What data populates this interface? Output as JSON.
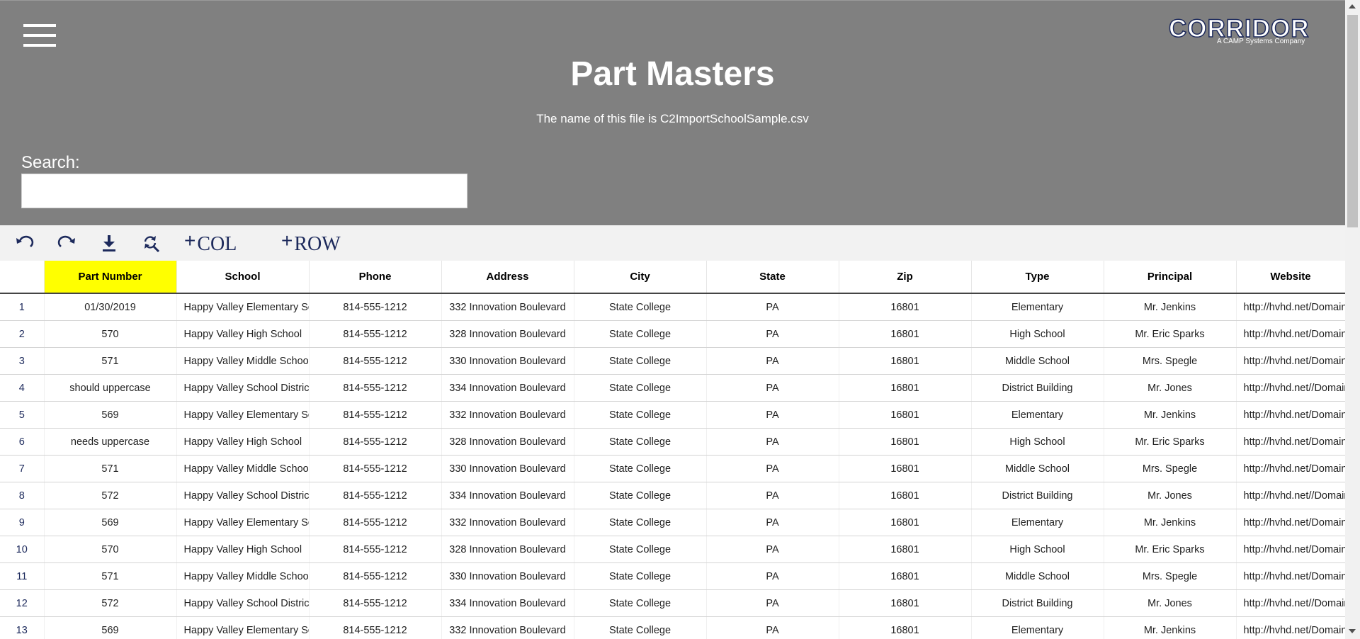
{
  "header": {
    "menu_icon": "hamburger-menu-icon",
    "logo_text": "CORRIDOR",
    "logo_tagline": "A CAMP Systems Company",
    "title": "Part Masters",
    "subtitle": "The name of this file is C2ImportSchoolSample.csv"
  },
  "search": {
    "label": "Search:",
    "value": "",
    "placeholder": ""
  },
  "toolbar": {
    "undo_icon": "undo-icon",
    "redo_icon": "redo-icon",
    "download_icon": "download-icon",
    "find_replace_icon": "find-replace-icon",
    "add_col_plus": "+",
    "add_col_label": "COL",
    "add_row_plus": "+",
    "add_row_label": "ROW"
  },
  "colors": {
    "header_bg": "#808080",
    "toolbar_bg": "#f2f2f2",
    "highlight": "#ffff00",
    "accent": "#1d2a5c"
  },
  "table": {
    "headers": [
      "Part Number",
      "School",
      "Phone",
      "Address",
      "City",
      "State",
      "Zip",
      "Type",
      "Principal",
      "Website"
    ],
    "highlighted_column": "Part Number",
    "rows": [
      {
        "n": "1",
        "cells": [
          "01/30/2019",
          "Happy Valley Elementary School",
          "814-555-1212",
          "332 Innovation Boulevard",
          "State College",
          "PA",
          "16801",
          "Elementary",
          "Mr. Jenkins",
          "http://hvhd.net/Domain"
        ]
      },
      {
        "n": "2",
        "cells": [
          "570",
          "Happy Valley High School",
          "814-555-1212",
          "328 Innovation Boulevard",
          "State College",
          "PA",
          "16801",
          "High School",
          "Mr. Eric Sparks",
          "http://hvhd.net/Domain"
        ]
      },
      {
        "n": "3",
        "cells": [
          "571",
          "Happy Valley Middle School",
          "814-555-1212",
          "330 Innovation Boulevard",
          "State College",
          "PA",
          "16801",
          "Middle School",
          "Mrs. Spegle",
          "http://hvhd.net/Domain"
        ]
      },
      {
        "n": "4",
        "cells": [
          "should uppercase",
          "Happy Valley School District",
          "814-555-1212",
          "334 Innovation Boulevard",
          "State College",
          "PA",
          "16801",
          "District Building",
          "Mr. Jones",
          "http://hvhd.net//Domain"
        ]
      },
      {
        "n": "5",
        "cells": [
          "569",
          "Happy Valley Elementary School",
          "814-555-1212",
          "332 Innovation Boulevard",
          "State College",
          "PA",
          "16801",
          "Elementary",
          "Mr. Jenkins",
          "http://hvhd.net/Domain"
        ]
      },
      {
        "n": "6",
        "cells": [
          "needs uppercase",
          "Happy Valley High School",
          "814-555-1212",
          "328 Innovation Boulevard",
          "State College",
          "PA",
          "16801",
          "High School",
          "Mr. Eric Sparks",
          "http://hvhd.net/Domain"
        ]
      },
      {
        "n": "7",
        "cells": [
          "571",
          "Happy Valley Middle School",
          "814-555-1212",
          "330 Innovation Boulevard",
          "State College",
          "PA",
          "16801",
          "Middle School",
          "Mrs. Spegle",
          "http://hvhd.net/Domain"
        ]
      },
      {
        "n": "8",
        "cells": [
          "572",
          "Happy Valley School District",
          "814-555-1212",
          "334 Innovation Boulevard",
          "State College",
          "PA",
          "16801",
          "District Building",
          "Mr. Jones",
          "http://hvhd.net//Domain"
        ]
      },
      {
        "n": "9",
        "cells": [
          "569",
          "Happy Valley Elementary School",
          "814-555-1212",
          "332 Innovation Boulevard",
          "State College",
          "PA",
          "16801",
          "Elementary",
          "Mr. Jenkins",
          "http://hvhd.net/Domain"
        ]
      },
      {
        "n": "10",
        "cells": [
          "570",
          "Happy Valley High School",
          "814-555-1212",
          "328 Innovation Boulevard",
          "State College",
          "PA",
          "16801",
          "High School",
          "Mr. Eric Sparks",
          "http://hvhd.net/Domain"
        ]
      },
      {
        "n": "11",
        "cells": [
          "571",
          "Happy Valley Middle School",
          "814-555-1212",
          "330 Innovation Boulevard",
          "State College",
          "PA",
          "16801",
          "Middle School",
          "Mrs. Spegle",
          "http://hvhd.net/Domain"
        ]
      },
      {
        "n": "12",
        "cells": [
          "572",
          "Happy Valley School District",
          "814-555-1212",
          "334 Innovation Boulevard",
          "State College",
          "PA",
          "16801",
          "District Building",
          "Mr. Jones",
          "http://hvhd.net//Domain"
        ]
      },
      {
        "n": "13",
        "cells": [
          "569",
          "Happy Valley Elementary School",
          "814-555-1212",
          "332 Innovation Boulevard",
          "State College",
          "PA",
          "16801",
          "Elementary",
          "Mr. Jenkins",
          "http://hvhd.net/Domain"
        ]
      }
    ]
  }
}
